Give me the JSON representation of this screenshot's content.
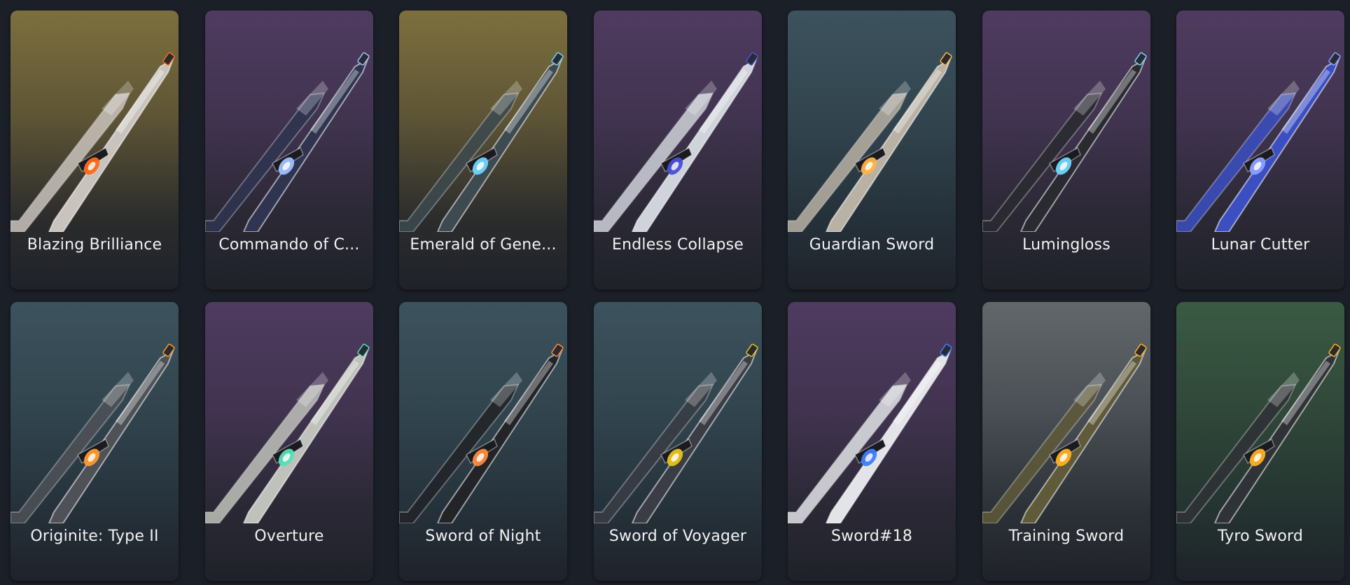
{
  "weapons": [
    {
      "name": "Blazing Brilliance",
      "rarity": "gold",
      "blade": "#c9c3bd",
      "accent": "#ff6a1a",
      "icon": "sword-blazing-brilliance-icon"
    },
    {
      "name": "Commando of C...",
      "rarity": "purple",
      "blade": "#2f3550",
      "accent": "#9ec0ff",
      "icon": "sword-commando-icon"
    },
    {
      "name": "Emerald of Gene...",
      "rarity": "gold",
      "blade": "#3d4a4f",
      "accent": "#6fd3ff",
      "icon": "sword-emerald-icon"
    },
    {
      "name": "Endless Collapse",
      "rarity": "purple",
      "blade": "#cfd3da",
      "accent": "#4a4fd8",
      "icon": "sword-endless-collapse-icon"
    },
    {
      "name": "Guardian Sword",
      "rarity": "blue",
      "blade": "#b9b1a4",
      "accent": "#ffb347",
      "icon": "sword-guardian-icon"
    },
    {
      "name": "Lumingloss",
      "rarity": "purple",
      "blade": "#2a2b30",
      "accent": "#6fd6ff",
      "icon": "sword-lumingloss-icon"
    },
    {
      "name": "Lunar Cutter",
      "rarity": "purple",
      "blade": "#3b4fc2",
      "accent": "#8aa0ff",
      "icon": "sword-lunar-cutter-icon"
    },
    {
      "name": "Originite: Type II",
      "rarity": "blue",
      "blade": "#4e5257",
      "accent": "#ff9a2e",
      "icon": "sword-originite-icon"
    },
    {
      "name": "Overture",
      "rarity": "purple",
      "blade": "#bfc2bb",
      "accent": "#56e0b5",
      "icon": "sword-overture-icon"
    },
    {
      "name": "Sword of Night",
      "rarity": "blue",
      "blade": "#222428",
      "accent": "#ff8a3a",
      "icon": "sword-of-night-icon"
    },
    {
      "name": "Sword of Voyager",
      "rarity": "blue",
      "blade": "#3a3d44",
      "accent": "#e8c21a",
      "icon": "sword-of-voyager-icon"
    },
    {
      "name": "Sword#18",
      "rarity": "purple",
      "blade": "#e2e4e8",
      "accent": "#3f7dff",
      "icon": "sword-18-icon"
    },
    {
      "name": "Training Sword",
      "rarity": "gray",
      "blade": "#5f5a3a",
      "accent": "#ffb020",
      "icon": "sword-training-icon"
    },
    {
      "name": "Tyro Sword",
      "rarity": "green",
      "blade": "#2f3236",
      "accent": "#ffb020",
      "icon": "sword-tyro-icon"
    }
  ]
}
